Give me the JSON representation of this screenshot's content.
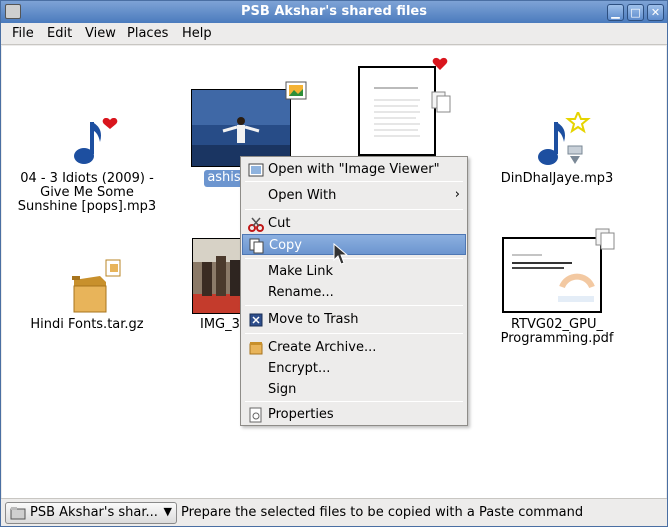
{
  "window": {
    "title": "PSB Akshar's shared files"
  },
  "menubar": {
    "file": "File",
    "edit": "Edit",
    "view": "View",
    "places": "Places",
    "help": "Help"
  },
  "files": [
    {
      "l1": "04 - 3 Idiots (2009) -",
      "l2": "Give Me Some",
      "l3": "Sunshine [pops].mp3"
    },
    {
      "l1": "ashis"
    },
    {
      "l1": "DinDhalJaye.mp3"
    },
    {
      "l1": "Hindi Fonts.tar.gz"
    },
    {
      "l1": "IMG_38"
    },
    {
      "l1": "RTVG02_GPU_",
      "l2": "Programming.pdf"
    }
  ],
  "context_menu": {
    "open_with_app": "Open with \"Image Viewer\"",
    "open_with": "Open With",
    "cut": "Cut",
    "copy": "Copy",
    "make_link": "Make Link",
    "rename": "Rename...",
    "move_to_trash": "Move to Trash",
    "create_archive": "Create Archive...",
    "encrypt": "Encrypt...",
    "sign": "Sign",
    "properties": "Properties"
  },
  "statusbar": {
    "location": "PSB Akshar's shar...",
    "message": "Prepare the selected files to be copied with a Paste command"
  },
  "colors": {
    "titlebar": "#4b7bbd",
    "selection": "#6c95cf",
    "note_icon": "#1d4fa0",
    "heart": "#d9151d"
  }
}
